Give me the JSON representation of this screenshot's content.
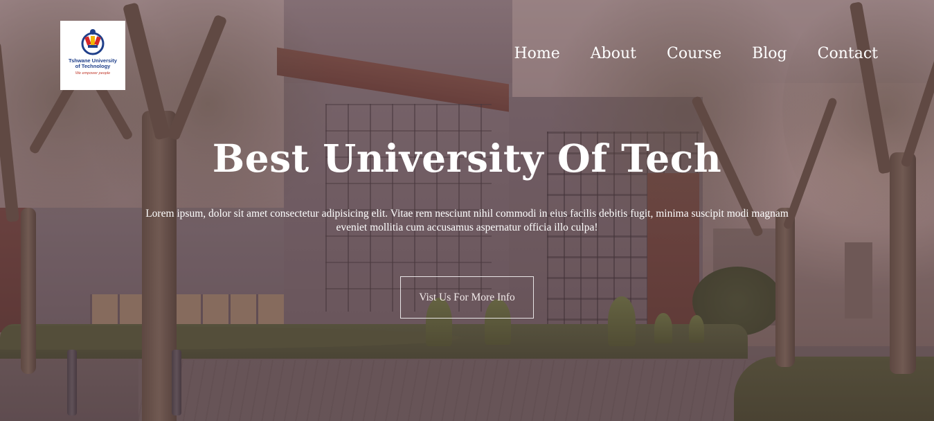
{
  "header": {
    "logo": {
      "name_line1": "Tshwane University",
      "name_line2": "of Technology",
      "tagline": "We empower people",
      "colors": {
        "blue": "#1f3f8a",
        "red": "#d62828",
        "yellow": "#f2b705"
      }
    },
    "nav": [
      {
        "label": "Home"
      },
      {
        "label": "About"
      },
      {
        "label": "Course"
      },
      {
        "label": "Blog"
      },
      {
        "label": "Contact"
      }
    ]
  },
  "hero": {
    "title": "Best University Of Tech",
    "lead": "Lorem ipsum, dolor sit amet consectetur adipisicing elit. Vitae rem nesciunt nihil commodi in eius facilis debitis fugit, minima suscipit modi magnam eveniet mollitia cum accusamus aspernatur officia illo culpa!",
    "cta_label": "Vist Us For More Info",
    "background_image": "campus building with trees",
    "overlay_color": "#4a2c32"
  }
}
